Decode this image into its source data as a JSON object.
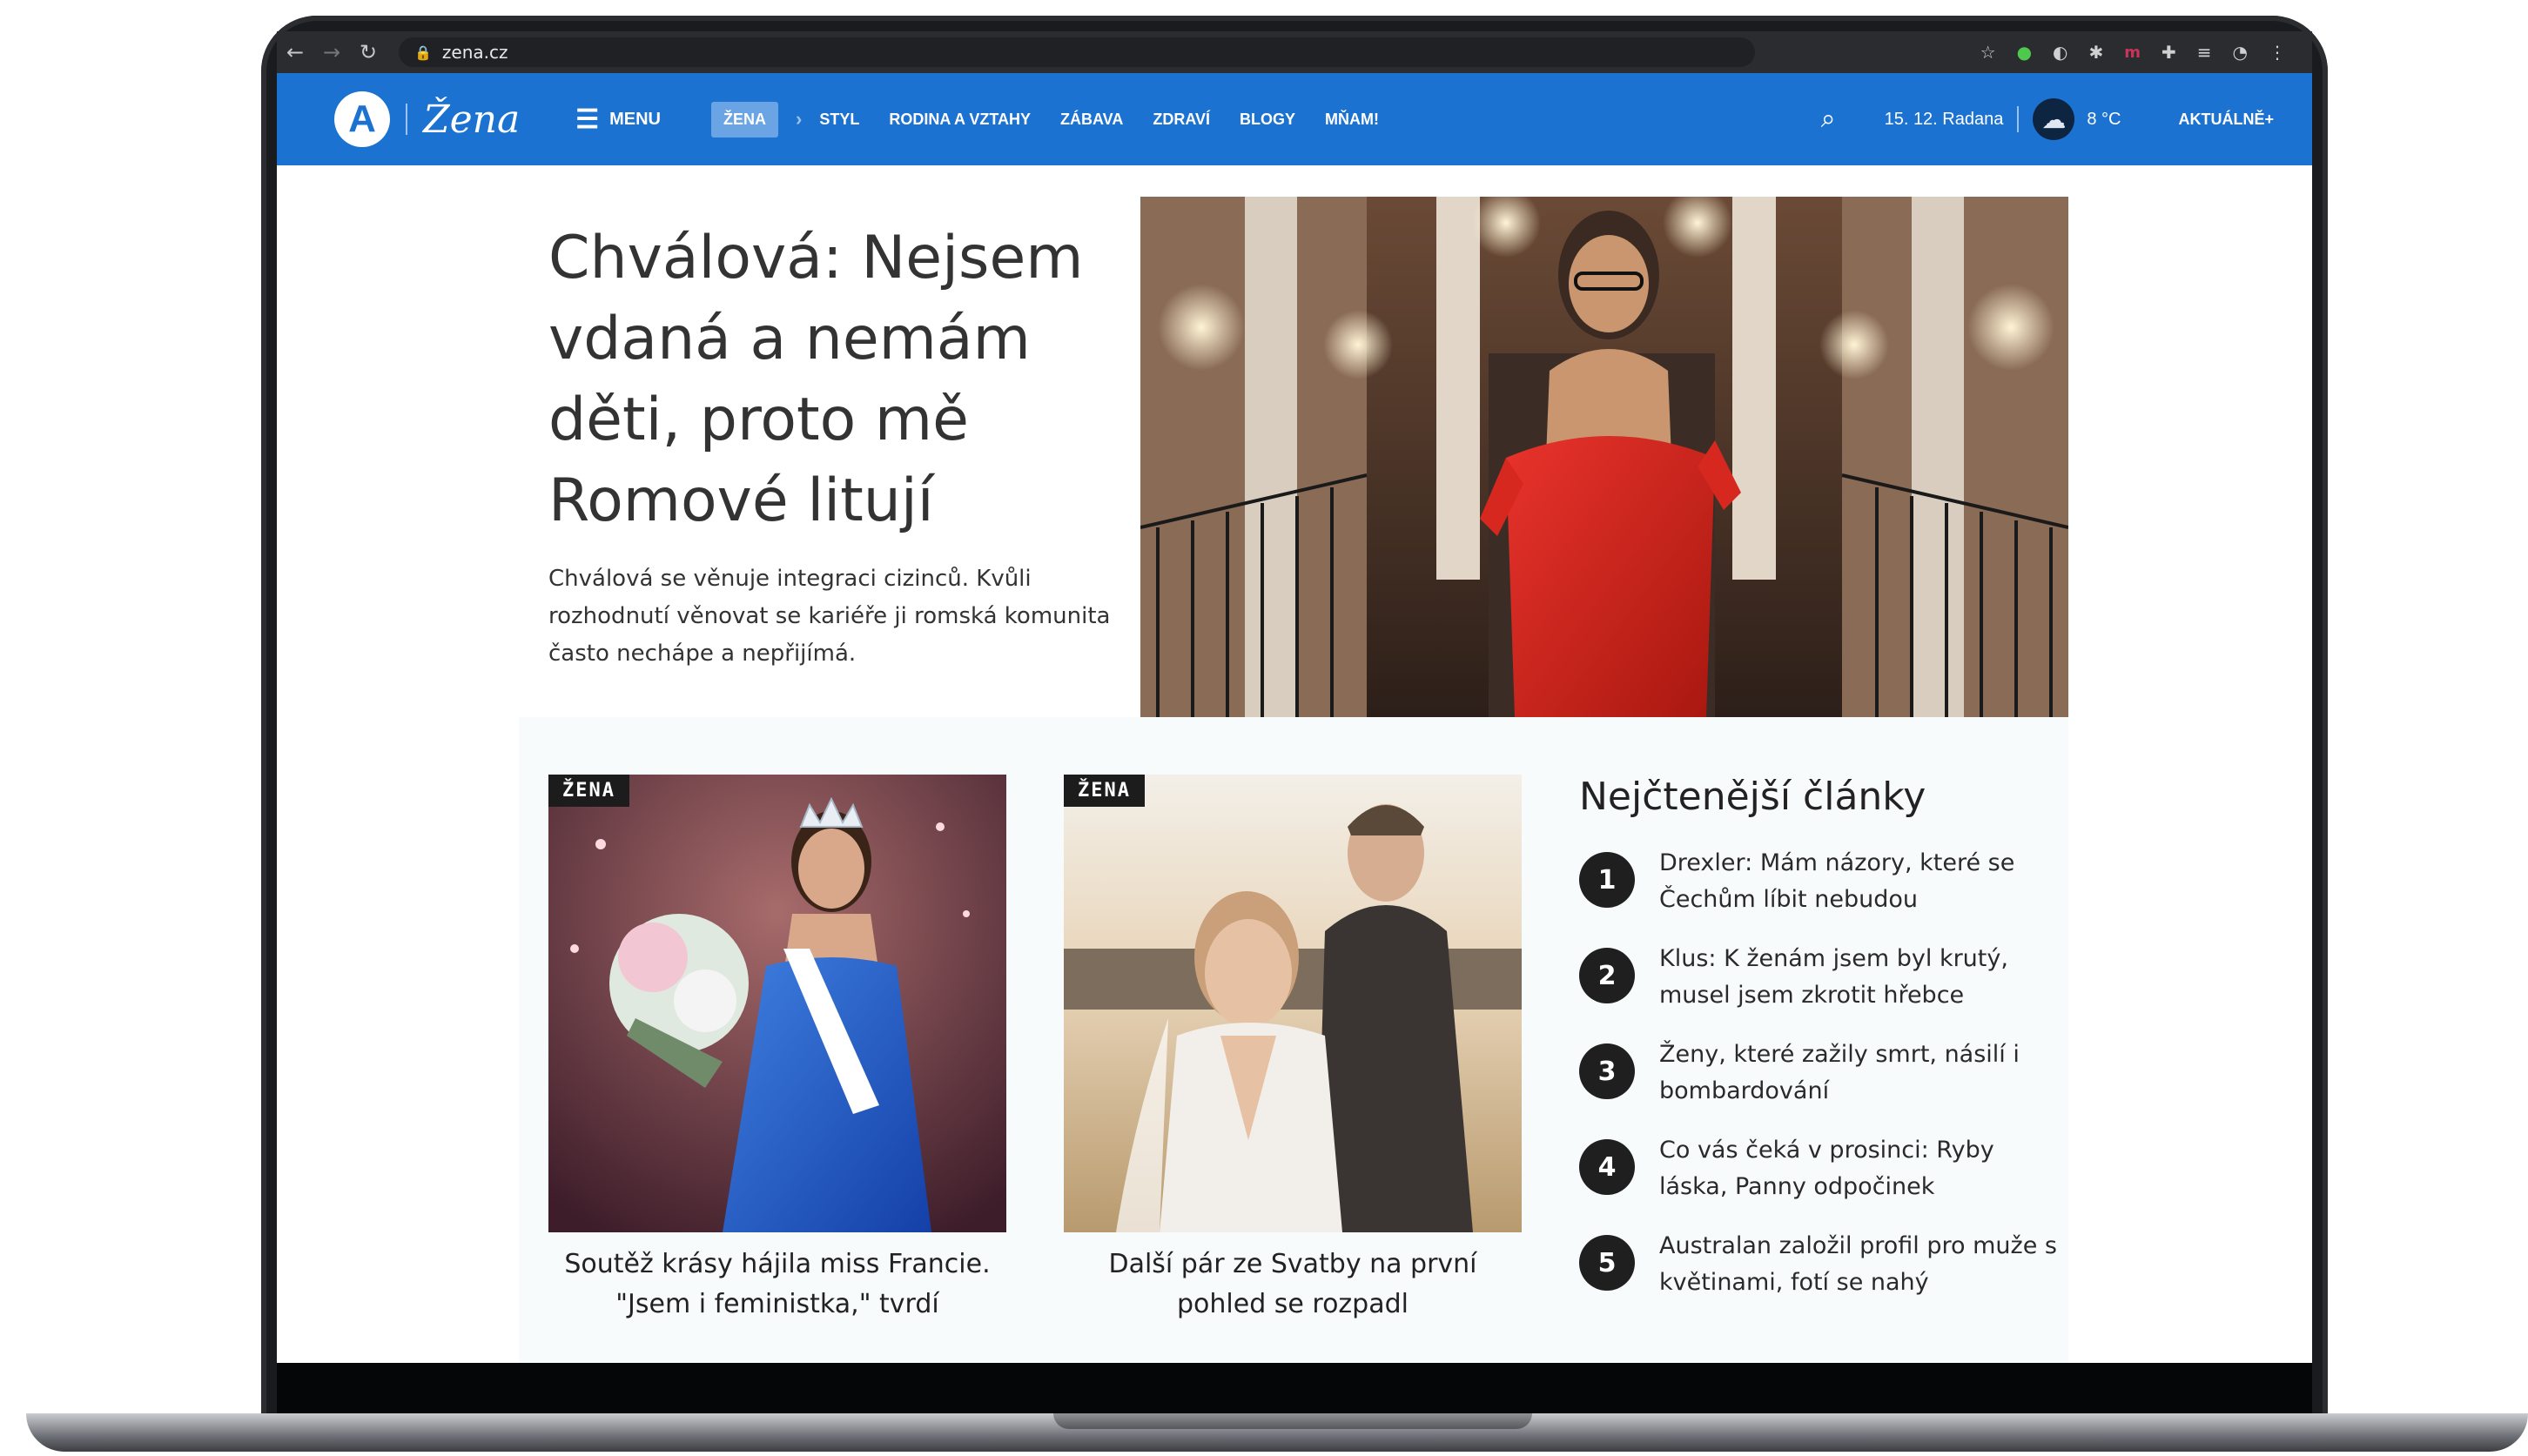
{
  "browser": {
    "url": "zena.cz",
    "icons": [
      "back-arrow-icon",
      "forward-arrow-icon",
      "reload-icon",
      "lock-icon",
      "star-icon",
      "extension-icon",
      "menu-dots-icon"
    ]
  },
  "header": {
    "logo_letter": "A",
    "logo_text": "Žena",
    "menu_label": "MENU",
    "nav": [
      {
        "label": "ŽENA"
      },
      {
        "label": "STYL"
      },
      {
        "label": "RODINA A VZTAHY"
      },
      {
        "label": "ZÁBAVA"
      },
      {
        "label": "ZDRAVÍ"
      },
      {
        "label": "BLOGY"
      },
      {
        "label": "MŇAM!"
      }
    ],
    "date": "15. 12. Radana",
    "temperature": "8 °C",
    "aktualne": "AKTUÁLNĚ+",
    "colors": {
      "brand_blue": "#1b72d1",
      "active_tab": "#6aa4e5"
    }
  },
  "hero": {
    "title": "Chválová: Nejsem vdaná a nemám děti, proto mě Romové litují",
    "description": "Chválová se věnuje integraci cizinců. Kvůli rozhodnutí věnovat se kariéře ji romská komunita často nechápe a nepřijímá."
  },
  "cards": [
    {
      "tag": "ŽENA",
      "title": "Soutěž krásy hájila miss Francie. \"Jsem i feministka,\" tvrdí"
    },
    {
      "tag": "ŽENA",
      "title": "Další pár ze Svatby na první pohled se rozpadl"
    }
  ],
  "most_read": {
    "title": "Nejčtenější články",
    "items": [
      {
        "num": "1",
        "text": "Drexler: Mám názory, které se Čechům líbit nebudou"
      },
      {
        "num": "2",
        "text": "Klus: K ženám jsem byl krutý, musel jsem zkrotit hřebce"
      },
      {
        "num": "3",
        "text": "Ženy, které zažily smrt, násilí i bombardování"
      },
      {
        "num": "4",
        "text": "Co vás čeká v prosinci: Ryby láska, Panny odpočinek"
      },
      {
        "num": "5",
        "text": "Australan založil profil pro muže s květinami, fotí se nahý"
      }
    ]
  }
}
